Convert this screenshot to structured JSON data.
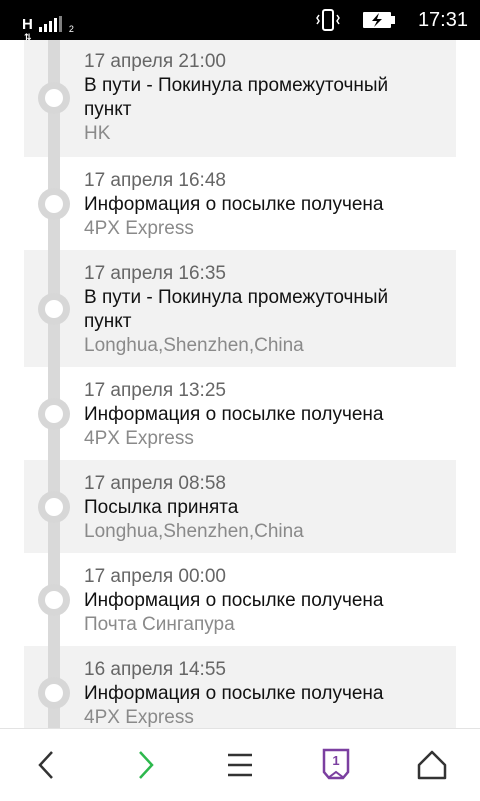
{
  "status_bar": {
    "network_letter": "H",
    "sim_slot": "2",
    "time": "17:31"
  },
  "events": [
    {
      "date": "17 апреля 21:00",
      "status_line1": "В пути - Покинула промежуточный",
      "status_line2": "пункт",
      "location": "HK"
    },
    {
      "date": "17 апреля 16:48",
      "status_line1": "Информация о посылке получена",
      "status_line2": "",
      "location": "4PX Express"
    },
    {
      "date": "17 апреля 16:35",
      "status_line1": "В пути - Покинула промежуточный",
      "status_line2": "пункт",
      "location": "Longhua,Shenzhen,China"
    },
    {
      "date": "17 апреля 13:25",
      "status_line1": "Информация о посылке получена",
      "status_line2": "",
      "location": "4PX Express"
    },
    {
      "date": "17 апреля 08:58",
      "status_line1": "Посылка принята",
      "status_line2": "",
      "location": "Longhua,Shenzhen,China"
    },
    {
      "date": "17 апреля 00:00",
      "status_line1": "Информация о посылке получена",
      "status_line2": "",
      "location": "Почта Сингапура"
    },
    {
      "date": "16 апреля 14:55",
      "status_line1": "Информация о посылке получена",
      "status_line2": "",
      "location": "4PX Express"
    }
  ],
  "navbar": {
    "icons": [
      "back-icon",
      "forward-icon",
      "menu-icon",
      "tabs-icon",
      "home-icon"
    ],
    "tab_count": "1",
    "forward_color": "#2db84d",
    "tabs_color": "#7b3fa0"
  }
}
